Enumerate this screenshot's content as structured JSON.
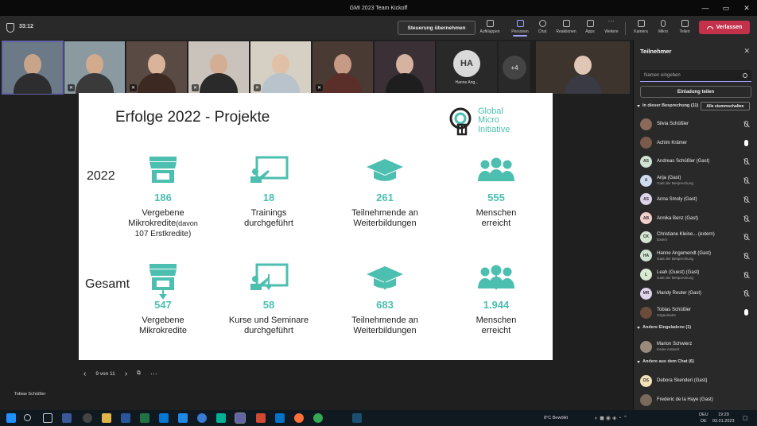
{
  "window": {
    "title": "GMI 2023 Team Kickoff"
  },
  "toolbar": {
    "timer": "33:12",
    "control_button": "Steuerung übernehmen",
    "tools": [
      "Aufklappen",
      "Personen",
      "Chat",
      "Reaktionen",
      "Apps",
      "Weitere",
      "Kamera",
      "Mikro",
      "Teilen"
    ],
    "leave_label": "Verlassen"
  },
  "thumbnails": {
    "avatar_initials": "HA",
    "avatar_name": "Hanne Ang...",
    "more_count": "+4"
  },
  "slide": {
    "title": "Erfolge 2022 - Projekte",
    "logo_lines": [
      "Global",
      "Micro",
      "Initiative"
    ],
    "row1_label": "2022",
    "row2_label": "Gesamt",
    "row1": [
      {
        "num": "186",
        "label": "Vergebene",
        "label2": "Mikrokredite",
        "note": "(davon",
        "note2": "107 Erstkredite)",
        "icon": "shop-icon"
      },
      {
        "num": "18",
        "label": "Trainings",
        "label2": "durchgeführt",
        "icon": "presentation-icon"
      },
      {
        "num": "261",
        "label": "Teilnehmende an",
        "label2": "Weiterbildungen",
        "icon": "graduation-cap-icon"
      },
      {
        "num": "555",
        "label": "Menschen",
        "label2": "erreicht",
        "icon": "people-icon"
      }
    ],
    "row2": [
      {
        "num": "547",
        "label": "Vergebene",
        "label2": "Mikrokredite",
        "icon": "shop-icon"
      },
      {
        "num": "58",
        "label": "Kurse und Seminare",
        "label2": "durchgeführt",
        "icon": "presentation-icon"
      },
      {
        "num": "683",
        "label": "Teilnehmende an",
        "label2": "Weiterbildungen",
        "icon": "graduation-cap-icon"
      },
      {
        "num": "1.944",
        "label": "Menschen",
        "label2": "erreicht",
        "icon": "people-icon"
      }
    ],
    "accent_color": "#4cbfb0"
  },
  "slide_nav": {
    "counter": "9 von 11",
    "presenter": "Tobias Schüßler"
  },
  "panel": {
    "title": "Teilnehmer",
    "search_placeholder": "Namen eingeben",
    "invite_label": "Einladung teilen",
    "in_meeting_label": "In dieser Besprechung (11)",
    "mute_all_label": "Alle stummschalten",
    "others_invited_label": "Andere Eingeladene (1)",
    "others_chat_label": "Andere aus dem Chat (6)",
    "participants": [
      {
        "initials": "",
        "name": "Silvia Schüßler",
        "sub": "",
        "color": "#8a6b5a",
        "mic": "off"
      },
      {
        "initials": "",
        "name": "Achim Krämer",
        "sub": "",
        "color": "#7a5a4a",
        "mic": "on"
      },
      {
        "initials": "AS",
        "name": "Andreas Schüßler (Gast)",
        "sub": "",
        "color": "#cfe3d2",
        "mic": "off"
      },
      {
        "initials": "A",
        "name": "Anja (Gast)",
        "sub": "Gast der Besprechung",
        "color": "#cfdcef",
        "mic": "off"
      },
      {
        "initials": "AS",
        "name": "Anna Smoly (Gast)",
        "sub": "",
        "color": "#ddd3ea",
        "mic": "off"
      },
      {
        "initials": "AB",
        "name": "Annika Benz (Gast)",
        "sub": "",
        "color": "#f2d0cd",
        "mic": "off"
      },
      {
        "initials": "CK",
        "name": "Christiane Kleine... (extern)",
        "sub": "Extern",
        "color": "#d6e4d2",
        "mic": "off"
      },
      {
        "initials": "HA",
        "name": "Hanne Angemendt (Gast)",
        "sub": "Gast der Besprechung",
        "color": "#cfe3d2",
        "mic": "off"
      },
      {
        "initials": "L",
        "name": "Leah (Guest) (Gast)",
        "sub": "Gast der Besprechung",
        "color": "#d9ead0",
        "mic": "off"
      },
      {
        "initials": "MR",
        "name": "Mandy Reuter (Gast)",
        "sub": "",
        "color": "#ddd3ea",
        "mic": "off"
      },
      {
        "initials": "",
        "name": "Tobias Schüßler",
        "sub": "Organisator",
        "color": "#6b4c3a",
        "mic": "on"
      }
    ],
    "invited": [
      {
        "initials": "",
        "name": "Marion Schwierz",
        "sub": "Keine Antwort",
        "color": "#9a8a7a"
      }
    ],
    "chat_others": [
      {
        "initials": "DS",
        "name": "Debora Skenderi (Gast)",
        "sub": "",
        "color": "#f2e2b8"
      },
      {
        "initials": "",
        "name": "Frederic de la Haye (Gast)",
        "sub": "",
        "color": "#7a6a5a"
      }
    ]
  },
  "taskbar": {
    "weather": "8°C  Bewölkt",
    "lang": "DEU",
    "lang2": "DE",
    "time": "19:29",
    "date": "03.01.2023"
  }
}
